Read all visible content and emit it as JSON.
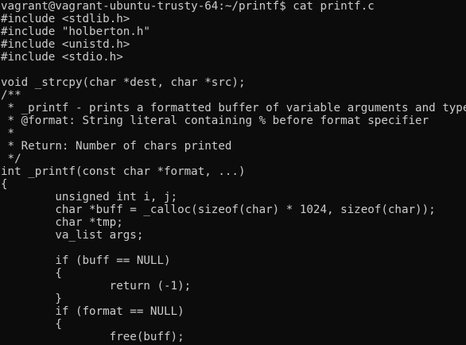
{
  "terminal": {
    "prompt": "vagrant@vagrant-ubuntu-trusty-64:~/printf$ cat printf.c",
    "lines": [
      "#include <stdlib.h>",
      "#include \"holberton.h\"",
      "#include <unistd.h>",
      "#include <stdio.h>",
      "",
      "void _strcpy(char *dest, char *src);",
      "/**",
      " * _printf - prints a formatted buffer of variable arguments and types",
      " * @format: String literal containing % before format specifier",
      " *",
      " * Return: Number of chars printed",
      " */",
      "int _printf(const char *format, ...)",
      "{",
      "        unsigned int i, j;",
      "        char *buff = _calloc(sizeof(char) * 1024, sizeof(char));",
      "        char *tmp;",
      "        va_list args;",
      "",
      "        if (buff == NULL)",
      "        {",
      "                return (-1);",
      "        }",
      "        if (format == NULL)",
      "        {",
      "                free(buff);"
    ]
  },
  "colors": {
    "background": "#0c0c0c",
    "text": "#cccccc"
  }
}
